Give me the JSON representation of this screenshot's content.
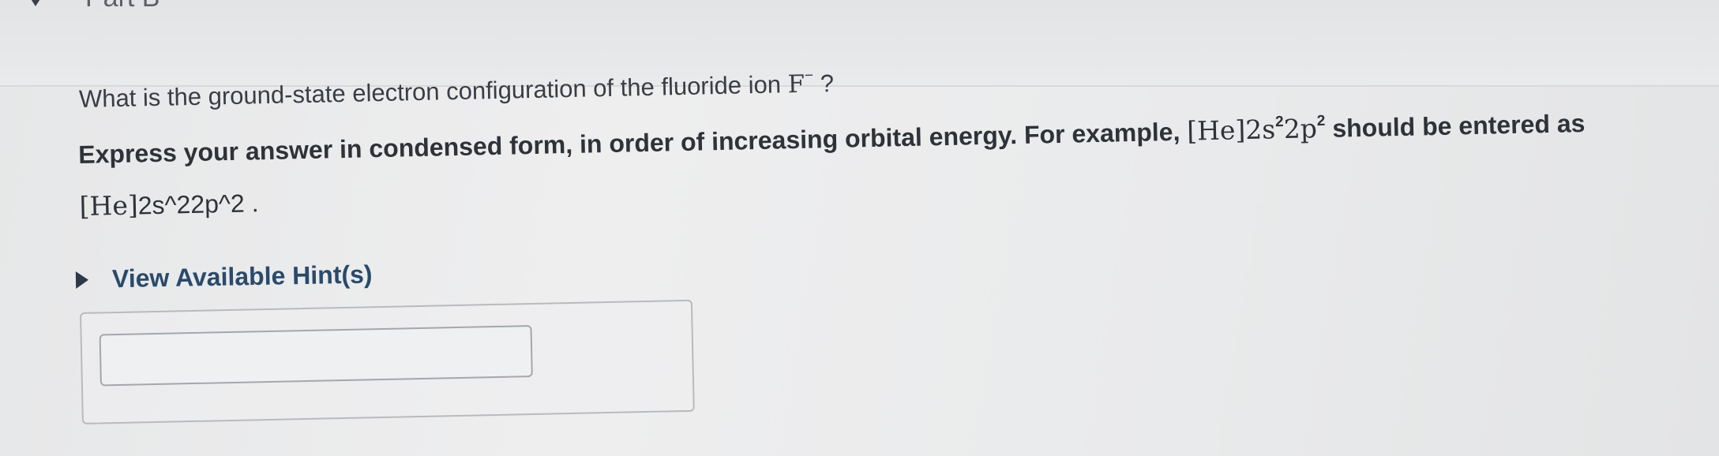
{
  "header": {
    "part_label": "Part B",
    "collapse_icon": "triangle-down-icon"
  },
  "question": {
    "text": "What is the ground-state electron configuration of the fluoride ion ",
    "ion_symbol": "F",
    "ion_charge": "−",
    "end": " ?"
  },
  "instruction": {
    "text_before": "Express your answer in condensed form, in order of increasing orbital energy. For example, ",
    "example_core": "[He]",
    "example_2s": "2s",
    "example_2s_exp": "2",
    "example_2p": "2p",
    "example_2p_exp": "2",
    "text_middle": " should be entered as ",
    "entered_core": "[He]",
    "entered_rest": "2s^22p^2",
    "text_end": " ."
  },
  "hint": {
    "label": "View Available Hint(s)",
    "icon": "triangle-right-icon"
  },
  "answer": {
    "value": "",
    "placeholder": ""
  }
}
